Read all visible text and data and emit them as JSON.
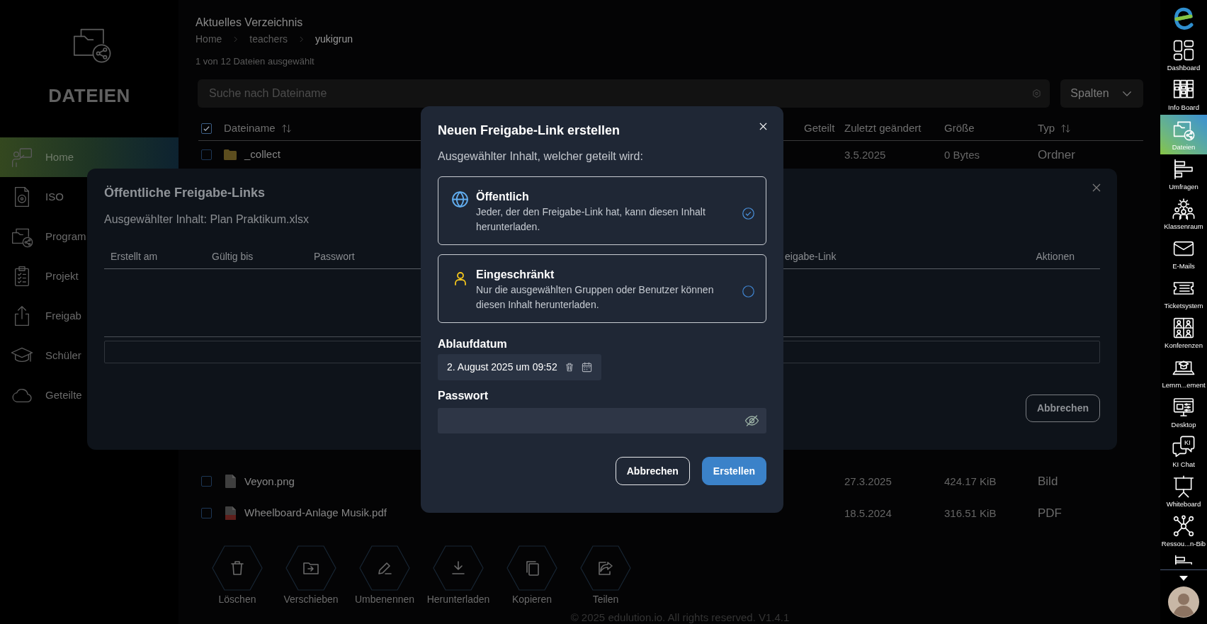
{
  "sidebar": {
    "title": "DATEIEN",
    "items": [
      {
        "label": "Home",
        "kind": "home",
        "selected": true
      },
      {
        "label": "ISO",
        "kind": "iso",
        "selected": false
      },
      {
        "label": "Program",
        "kind": "programs",
        "selected": false
      },
      {
        "label": "Projekt",
        "kind": "projects",
        "selected": false
      },
      {
        "label": "Freigab",
        "kind": "shares",
        "selected": false
      },
      {
        "label": "Schüler",
        "kind": "students",
        "selected": false
      },
      {
        "label": "Geteilte",
        "kind": "cloud",
        "selected": false
      }
    ]
  },
  "directory": {
    "title": "Aktuelles Verzeichnis",
    "breadcrumb": [
      "Home",
      "teachers",
      "yukigrun"
    ],
    "selection_info": "1 von 12 Dateien ausgewählt"
  },
  "search": {
    "placeholder": "Suche nach Dateiname"
  },
  "columns_button": {
    "label": "Spalten"
  },
  "file_table": {
    "select_all_checked": true,
    "columns": [
      {
        "label": "Dateiname",
        "sortable": true
      },
      {
        "label": "Geteilt",
        "sortable": false
      },
      {
        "label": "Zuletzt geändert",
        "sortable": false
      },
      {
        "label": "Größe",
        "sortable": false
      },
      {
        "label": "Typ",
        "sortable": true
      }
    ],
    "rows_top": [
      {
        "name": "_collect",
        "kind": "folder",
        "checked": false,
        "modified": "3.5.2025",
        "size": "0 Bytes",
        "type": "Ordner"
      }
    ],
    "rows_bottom": [
      {
        "name": "Veyon.png",
        "kind": "image",
        "checked": false,
        "modified": "27.3.2025",
        "size": "424.17 KiB",
        "type": "Bild"
      },
      {
        "name": "Wheelboard-Anlage Musik.pdf",
        "kind": "pdf",
        "checked": false,
        "modified": "18.5.2024",
        "size": "316.51 KiB",
        "type": "PDF"
      }
    ]
  },
  "actions": [
    {
      "label": "Löschen",
      "kind": "delete"
    },
    {
      "label": "Verschieben",
      "kind": "move"
    },
    {
      "label": "Umbenennen",
      "kind": "rename"
    },
    {
      "label": "Herunterladen",
      "kind": "download"
    },
    {
      "label": "Kopieren",
      "kind": "copy"
    },
    {
      "label": "Teilen",
      "kind": "share"
    }
  ],
  "footer": "© 2025 edulution.io. All rights reserved. V1.4.1",
  "app_bar": {
    "items": [
      {
        "label": "Dashboard",
        "kind": "dashboard",
        "selected": false
      },
      {
        "label": "Info Board",
        "kind": "infoboard",
        "selected": false
      },
      {
        "label": "Dateien",
        "kind": "files",
        "selected": true
      },
      {
        "label": "Umfragen",
        "kind": "polls",
        "selected": false
      },
      {
        "label": "Klassenraum",
        "kind": "classroom",
        "selected": false
      },
      {
        "label": "E-Mails",
        "kind": "mail",
        "selected": false
      },
      {
        "label": "Ticketsystem",
        "kind": "tickets",
        "selected": false
      },
      {
        "label": "Konferenzen",
        "kind": "conference",
        "selected": false
      },
      {
        "label": "Lernm...ement",
        "kind": "learning",
        "selected": false
      },
      {
        "label": "Desktop",
        "kind": "desktop",
        "selected": false
      },
      {
        "label": "KI Chat",
        "kind": "chat",
        "icon_text": "KI",
        "selected": false
      },
      {
        "label": "Whiteboard",
        "kind": "whiteboard",
        "selected": false
      },
      {
        "label": "Ressou...n-Bib",
        "kind": "resources",
        "selected": false
      },
      {
        "kind": "polls",
        "selected": false
      }
    ]
  },
  "share_links_dialog": {
    "title": "Öffentliche Freigabe-Links",
    "selected_content": "Ausgewählter Inhalt: Plan Praktikum.xlsx",
    "columns": [
      "Erstellt am",
      "Gültig bis",
      "Passwort",
      "eigabe-Link",
      "Aktionen"
    ],
    "cancel_button": "Abbrechen"
  },
  "create_link_dialog": {
    "title": "Neuen Freigabe-Link erstellen",
    "subtitle": "Ausgewählter Inhalt, welcher geteilt wird:",
    "options": [
      {
        "kind": "public",
        "title": "Öffentlich",
        "description": "Jeder, der den Freigabe-Link hat, kann diesen Inhalt herunterladen.",
        "selected": true
      },
      {
        "kind": "restricted",
        "title": "Eingeschränkt",
        "description": "Nur die ausgewählten Gruppen oder Benutzer können diesen Inhalt herunterladen.",
        "selected": false
      }
    ],
    "expiry": {
      "label": "Ablaufdatum",
      "value": "2. August 2025 um 09:52"
    },
    "password": {
      "label": "Passwort"
    },
    "buttons": [
      {
        "label": "Abbrechen",
        "kind": "secondary"
      },
      {
        "label": "Erstellen",
        "kind": "primary"
      }
    ]
  }
}
